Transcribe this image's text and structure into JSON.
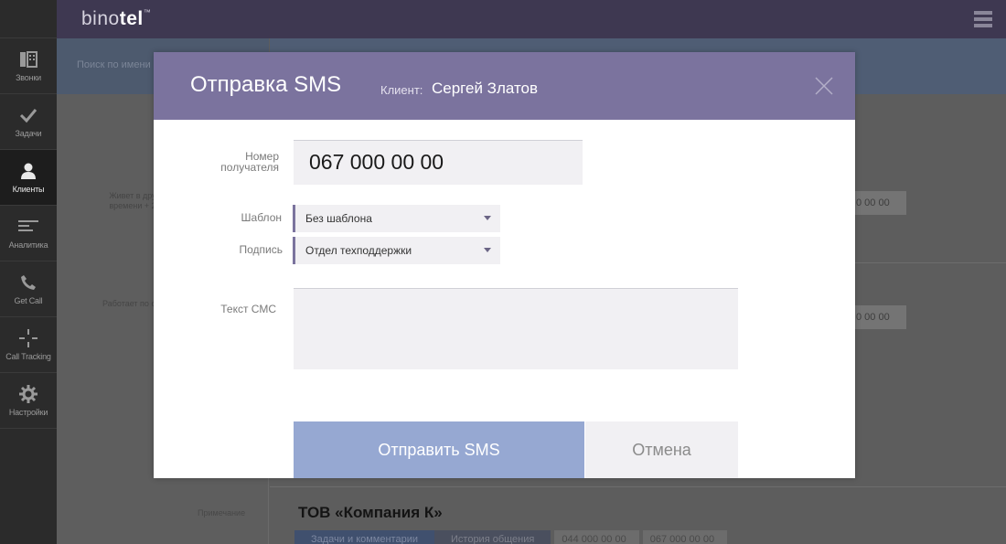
{
  "app": {
    "brand_light": "bino",
    "brand_bold": "tel",
    "brand_mark": "™"
  },
  "sidebar": {
    "items": [
      {
        "label": "Звонки",
        "icon": "calls-icon"
      },
      {
        "label": "Задачи",
        "icon": "check-icon"
      },
      {
        "label": "Клиенты",
        "icon": "user-icon",
        "active": true
      },
      {
        "label": "Аналитика",
        "icon": "analytics-icon"
      },
      {
        "label": "Get Call",
        "icon": "phone-icon"
      },
      {
        "label": "Call Tracking",
        "icon": "crosshair-icon"
      },
      {
        "label": "Настройки",
        "icon": "gear-icon"
      }
    ]
  },
  "background": {
    "search_placeholder": "Поиск по имени",
    "note_1": "Живет в дру\nвремени + 2",
    "note_2": "Работает по с",
    "phone_chip_1": "0 00 00",
    "phone_chip_2": "0 00 00",
    "note_label": "Примечание",
    "company_title": "ТОВ «Компания К»",
    "tab_tasks": "Задачи и комментарии",
    "tab_history": "История общения",
    "chip_phone_1": "044 000 00 00",
    "chip_phone_2": "067 000 00 00"
  },
  "modal": {
    "title": "Отправка SMS",
    "client_label": "Клиент:",
    "client_name": "Сергей Златов",
    "phone_label": "Номер\nполучателя",
    "phone_value": "067 000 00 00",
    "template_label": "Шаблон",
    "template_value": "Без шаблона",
    "signature_label": "Подпись",
    "signature_value": "Отдел техподдержки",
    "text_label": "Текст СМС",
    "text_value": "",
    "send_label": "Отправить SMS",
    "cancel_label": "Отмена"
  },
  "colors": {
    "modal_header": "#7b739e",
    "send_button": "#96a8d2",
    "sidebar_bg": "#2b2b2b",
    "topbar_bg": "#3e3851"
  }
}
